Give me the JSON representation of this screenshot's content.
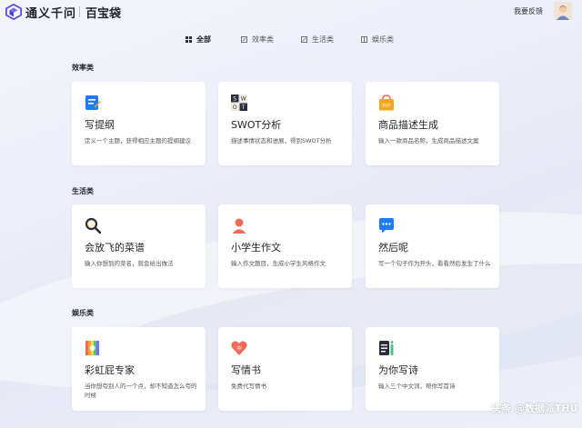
{
  "header": {
    "brand": "通义千问",
    "subtitle": "百宝袋",
    "feedback_label": "我要反馈"
  },
  "tabs": [
    {
      "label": "全部",
      "icon": "grid-icon",
      "active": true
    },
    {
      "label": "效率类",
      "icon": "edit-icon",
      "active": false
    },
    {
      "label": "生活类",
      "icon": "edit-icon",
      "active": false
    },
    {
      "label": "娱乐类",
      "icon": "book-icon",
      "active": false
    }
  ],
  "sections": [
    {
      "title": "效率类",
      "cards": [
        {
          "title": "写提纲",
          "desc": "定义一个主题，获得相应主题的提纲建议",
          "icon": "document-icon"
        },
        {
          "title": "SWOT分析",
          "desc": "描述事情状态和进展，得到SWOT分析",
          "icon": "swot-icon"
        },
        {
          "title": "商品描述生成",
          "desc": "输入一款商品名称，生成商品描述文案",
          "icon": "shopping-bag-icon"
        }
      ]
    },
    {
      "title": "生活类",
      "cards": [
        {
          "title": "会放飞的菜谱",
          "desc": "输入你想到的菜名，就会给出做法",
          "icon": "magnifier-icon"
        },
        {
          "title": "小学生作文",
          "desc": "输入作文题目，生成小学生风格作文",
          "icon": "student-icon"
        },
        {
          "title": "然后呢",
          "desc": "写一个句子作为开头，看看然后发生了什么",
          "icon": "chat-bubble-icon"
        }
      ]
    },
    {
      "title": "娱乐类",
      "cards": [
        {
          "title": "彩虹屁专家",
          "desc": "当你想夸别人的一个点，却不知道怎么夸的时候",
          "icon": "rainbow-icon"
        },
        {
          "title": "写情书",
          "desc": "免费代写情书",
          "icon": "love-letter-icon"
        },
        {
          "title": "为你写诗",
          "desc": "输入三个中文词，帮你写首诗",
          "icon": "poem-icon"
        }
      ]
    }
  ],
  "watermark": "头条 @数据派THU",
  "colors": {
    "accent": "#1f7bf5",
    "orange": "#f5a623",
    "red": "#f06a5a",
    "dark": "#2b2d3a"
  }
}
